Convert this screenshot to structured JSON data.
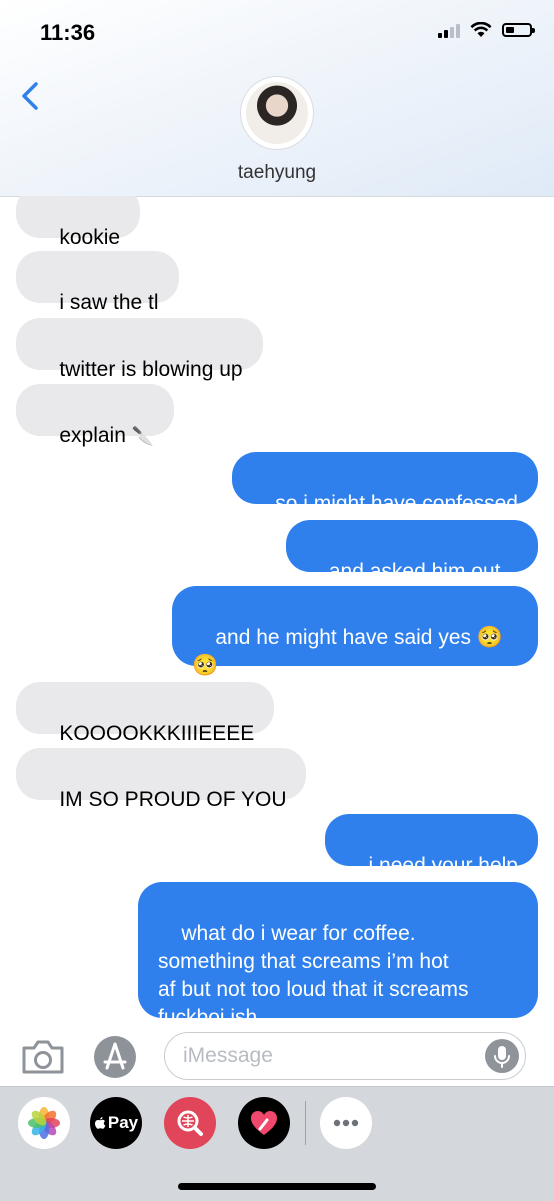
{
  "status_bar": {
    "time": "11:36",
    "icons": [
      "signal-icon",
      "wifi-icon",
      "battery-icon"
    ]
  },
  "header": {
    "contact_name": "taehyung",
    "back_icon": "chevron-left-icon"
  },
  "messages": [
    {
      "direction": "incoming",
      "text": "kookie"
    },
    {
      "direction": "incoming",
      "text": "i saw the tl"
    },
    {
      "direction": "incoming",
      "text": "twitter is blowing up"
    },
    {
      "direction": "incoming",
      "text": "explain",
      "emoji": "🔪"
    },
    {
      "direction": "outgoing",
      "text": "so i might have confessed"
    },
    {
      "direction": "outgoing",
      "text": "and asked him out..."
    },
    {
      "direction": "outgoing",
      "text": "and he might have said yes 🥺\n🥺"
    },
    {
      "direction": "incoming",
      "text": "KOOOOKKKIIIEEEE"
    },
    {
      "direction": "incoming",
      "text": "IM SO PROUD OF YOU"
    },
    {
      "direction": "outgoing",
      "text": "i need your help"
    },
    {
      "direction": "outgoing",
      "text": "what do i wear for coffee.\nsomething that screams i’m hot\naf but not too loud that it screams\nfuckboi ish"
    }
  ],
  "input_bar": {
    "placeholder": "iMessage",
    "icons": [
      "camera-icon",
      "app-store-icon",
      "microphone-icon"
    ]
  },
  "app_drawer": {
    "apple_pay_label": "Pay",
    "apps": [
      "photos-icon",
      "apple-pay-icon",
      "image-search-icon",
      "heart-sticker-icon",
      "more-icon"
    ]
  },
  "colors": {
    "outgoing_bubble": "#2f80ed",
    "incoming_bubble": "#e9e9eb",
    "accent": "#2f80ed"
  }
}
